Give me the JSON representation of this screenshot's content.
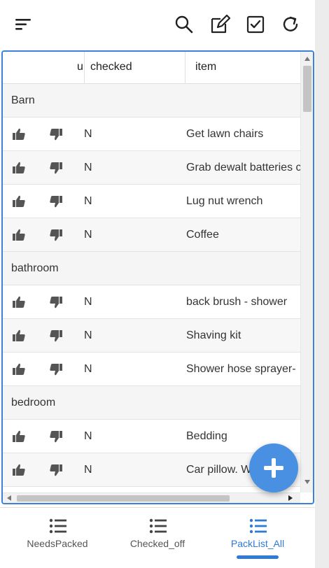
{
  "toolbar": {
    "icons": [
      "menu-icon",
      "search-icon",
      "edit-icon",
      "checkbox-icon",
      "refresh-icon"
    ]
  },
  "table": {
    "columns": {
      "u": "u",
      "checked": "checked",
      "item": "item"
    },
    "groups": [
      {
        "label": "Barn",
        "rows": [
          {
            "flag": "N",
            "item": "Get lawn chairs"
          },
          {
            "flag": "N",
            "item": "Grab dewalt batteries c"
          },
          {
            "flag": "N",
            "item": "Lug nut wrench"
          },
          {
            "flag": "N",
            "item": "Coffee"
          }
        ]
      },
      {
        "label": "bathroom",
        "rows": [
          {
            "flag": "N",
            "item": "back brush - shower"
          },
          {
            "flag": "N",
            "item": "Shaving kit"
          },
          {
            "flag": "N",
            "item": "Shower hose sprayer-"
          }
        ]
      },
      {
        "label": "bedroom",
        "rows": [
          {
            "flag": "N",
            "item": "Bedding"
          },
          {
            "flag": "N",
            "item": "Car pillow. W"
          }
        ]
      }
    ]
  },
  "fab": {
    "icon": "plus-icon"
  },
  "bottom_nav": {
    "tabs": [
      {
        "label": "NeedsPacked",
        "active": false
      },
      {
        "label": "Checked_off",
        "active": false
      },
      {
        "label": "PackList_All",
        "active": true
      }
    ]
  },
  "colors": {
    "accent": "#2f7ad6",
    "fab": "#4a90e2",
    "frame": "#3b82d6"
  }
}
